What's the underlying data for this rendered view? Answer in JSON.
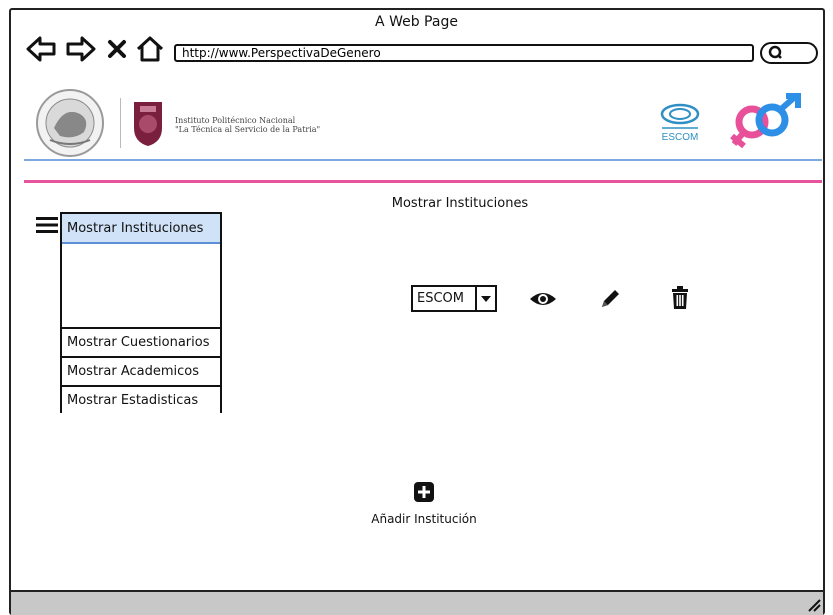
{
  "window": {
    "title": "A Web Page"
  },
  "browser": {
    "url": "http://www.PerspectivaDeGenero",
    "back_icon": "arrow-left-icon",
    "forward_icon": "arrow-right-icon",
    "stop_icon": "close-icon",
    "home_icon": "home-icon",
    "search_icon": "search-icon"
  },
  "header": {
    "institution_line1": "Instituto Politécnico Nacional",
    "institution_line2": "\"La Técnica al Servicio de la Patria\"",
    "escom_logo_text": "ESCOM"
  },
  "colors": {
    "blue_rule": "#7da9e0",
    "pink_rule": "#e6559c",
    "active_menu": "#cfe2f7",
    "male_symbol": "#2d8fe6",
    "female_symbol": "#e8509a"
  },
  "main": {
    "title": "Mostrar Instituciones",
    "selector_value": "ESCOM",
    "add_label": "Añadir Institución"
  },
  "menu": {
    "active": "Mostrar Instituciones",
    "items": [
      "Mostrar Cuestionarios",
      "Mostrar Academicos",
      "Mostrar Estadisticas"
    ]
  }
}
